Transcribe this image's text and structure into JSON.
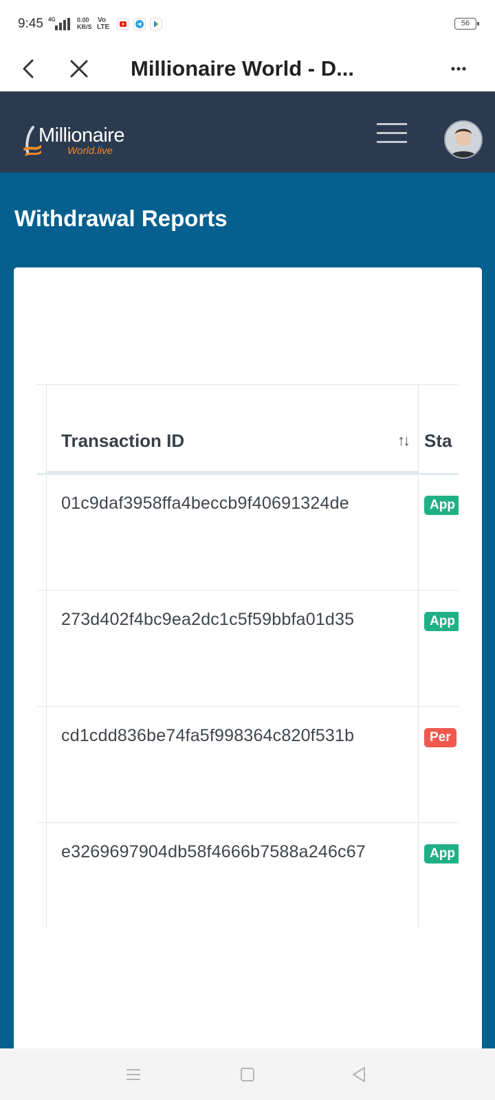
{
  "status_bar": {
    "time": "9:45",
    "network": "4G",
    "speed_value": "0.00",
    "speed_unit": "KB/S",
    "volte_top": "Vo",
    "volte_bottom": "LTE",
    "battery": "56"
  },
  "browser": {
    "title": "Millionaire World - D..."
  },
  "site": {
    "logo_main": "Millionaire",
    "logo_sub": "World.live"
  },
  "page": {
    "title": "Withdrawal Reports"
  },
  "table": {
    "columns": [
      "Transaction ID",
      "Sta"
    ],
    "sort_icon": "↑↓",
    "rows": [
      {
        "id": "01c9daf3958ffa4beccb9f40691324de",
        "status": "App",
        "status_color": "#1fb185"
      },
      {
        "id": "273d402f4bc9ea2dc1c5f59bbfa01d35",
        "status": "App",
        "status_color": "#1fb185"
      },
      {
        "id": "cd1cdd836be74fa5f998364c820f531b",
        "status": "Per",
        "status_color": "#f0584d"
      },
      {
        "id": "e3269697904db58f4666b7588a246c67",
        "status": "App",
        "status_color": "#1fb185"
      }
    ]
  },
  "colors": {
    "header_bg": "#2b3a4f",
    "page_bg": "#05608f",
    "approved": "#1fb185",
    "pending": "#f0584d",
    "logo_accent": "#f08b2a"
  },
  "icons": {
    "back": "back-arrow-icon",
    "close": "close-icon",
    "more": "more-dots-icon",
    "menu": "hamburger-icon",
    "sort": "sort-icon",
    "nav_menu": "nav-menu-icon",
    "nav_home": "nav-home-icon",
    "nav_back": "nav-back-icon"
  }
}
